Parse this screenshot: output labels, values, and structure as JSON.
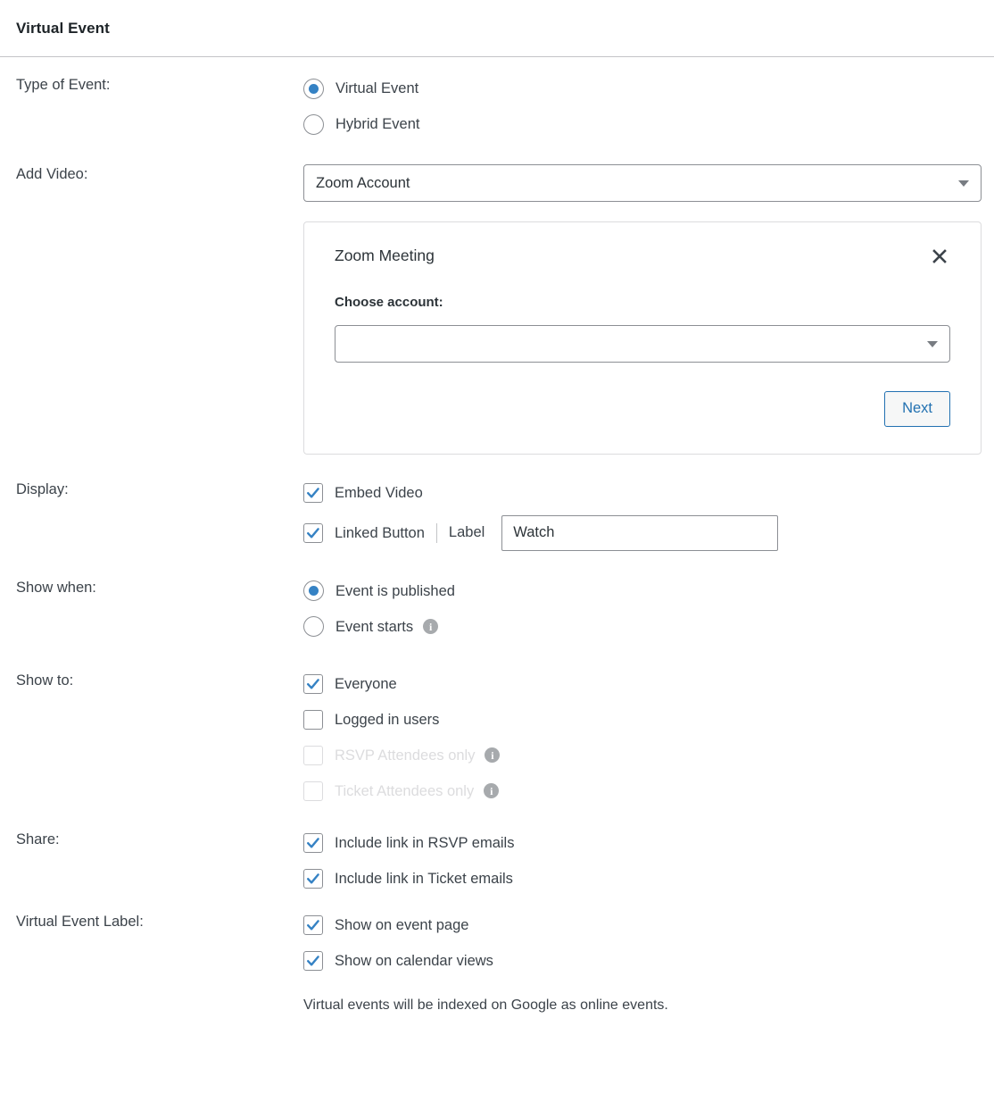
{
  "header": {
    "title": "Virtual Event"
  },
  "rows": {
    "type_of_event": {
      "label": "Type of Event:",
      "options": [
        {
          "label": "Virtual Event",
          "checked": true
        },
        {
          "label": "Hybrid Event",
          "checked": false
        }
      ]
    },
    "add_video": {
      "label": "Add Video:",
      "select_value": "Zoom Account"
    },
    "display": {
      "label": "Display:",
      "embed_video": {
        "label": "Embed Video",
        "checked": true
      },
      "linked_button": {
        "label": "Linked Button",
        "checked": true
      },
      "label_word": "Label",
      "label_value": "Watch",
      "label_placeholder": "Watch"
    },
    "show_when": {
      "label": "Show when:",
      "options": [
        {
          "label": "Event is published",
          "checked": true,
          "info": false
        },
        {
          "label": "Event starts",
          "checked": false,
          "info": true
        }
      ]
    },
    "show_to": {
      "label": "Show to:",
      "options": [
        {
          "label": "Everyone",
          "checked": true,
          "disabled": false,
          "info": false
        },
        {
          "label": "Logged in users",
          "checked": false,
          "disabled": false,
          "info": false
        },
        {
          "label": "RSVP Attendees only",
          "checked": false,
          "disabled": true,
          "info": true
        },
        {
          "label": "Ticket Attendees only",
          "checked": false,
          "disabled": true,
          "info": true
        }
      ]
    },
    "share": {
      "label": "Share:",
      "options": [
        {
          "label": "Include link in RSVP emails",
          "checked": true
        },
        {
          "label": "Include link in Ticket emails",
          "checked": true
        }
      ]
    },
    "virtual_event_label": {
      "label": "Virtual Event Label:",
      "options": [
        {
          "label": "Show on event page",
          "checked": true
        },
        {
          "label": "Show on calendar views",
          "checked": true
        }
      ],
      "footnote": "Virtual events will be indexed on Google as online events."
    }
  },
  "zoom_panel": {
    "title": "Zoom Meeting",
    "close_icon": "close-icon",
    "choose_account_label": "Choose account:",
    "account_value": "",
    "account_placeholder": "",
    "next_label": "Next"
  },
  "icons": {
    "info": "i",
    "dropdown": "chevron-down-icon"
  },
  "colors": {
    "accent_blue": "#3582c4",
    "link_blue": "#2271b1",
    "border_gray": "#8c8f94",
    "disabled_gray": "#dcdcde",
    "text": "#3c434a"
  }
}
